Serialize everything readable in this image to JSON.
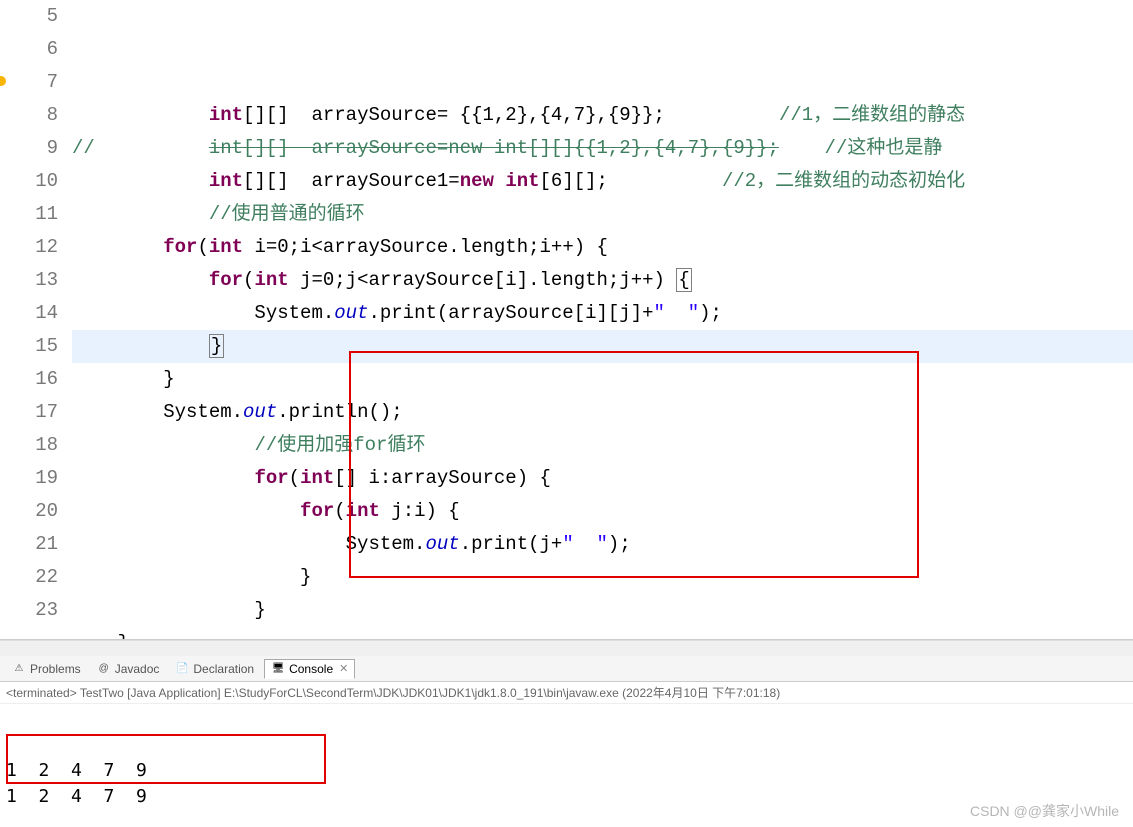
{
  "gutter": {
    "start": 5,
    "end": 23
  },
  "code_lines": [
    {
      "n": 5,
      "segs": [
        {
          "t": "            "
        },
        {
          "t": "int",
          "c": "kw"
        },
        {
          "t": "[][]  arraySource= {{1,2},{4,7},{9}};          "
        },
        {
          "t": "//1，二维数组的静态",
          "c": "comment"
        }
      ]
    },
    {
      "n": 6,
      "segs": [
        {
          "t": "//",
          "c": "comment"
        },
        {
          "t": "          "
        },
        {
          "t": "int[][]  arraySource=new int[][]{{1,2},{4,7},{9}};",
          "c": "comment-strike"
        },
        {
          "t": "    "
        },
        {
          "t": "//这种也是静",
          "c": "comment"
        }
      ]
    },
    {
      "n": 7,
      "segs": [
        {
          "t": "            "
        },
        {
          "t": "int",
          "c": "kw"
        },
        {
          "t": "[][]  arraySource1="
        },
        {
          "t": "new",
          "c": "kw"
        },
        {
          "t": " "
        },
        {
          "t": "int",
          "c": "kw"
        },
        {
          "t": "[6][];          "
        },
        {
          "t": "//2，二维数组的动态初始化",
          "c": "comment"
        }
      ],
      "marker": "warn"
    },
    {
      "n": 8,
      "segs": [
        {
          "t": "            "
        },
        {
          "t": "//使用普通的循环",
          "c": "comment"
        }
      ]
    },
    {
      "n": 9,
      "segs": [
        {
          "t": "        "
        },
        {
          "t": "for",
          "c": "kw"
        },
        {
          "t": "("
        },
        {
          "t": "int",
          "c": "kw"
        },
        {
          "t": " i=0;i<arraySource.length;i++) {"
        }
      ]
    },
    {
      "n": 10,
      "segs": [
        {
          "t": "            "
        },
        {
          "t": "for",
          "c": "kw"
        },
        {
          "t": "("
        },
        {
          "t": "int",
          "c": "kw"
        },
        {
          "t": " j=0;j<arraySource[i].length;j++) "
        },
        {
          "t": "{",
          "c": "match-brace"
        }
      ]
    },
    {
      "n": 11,
      "segs": [
        {
          "t": "                System."
        },
        {
          "t": "out",
          "c": "field"
        },
        {
          "t": ".print(arraySource[i][j]+"
        },
        {
          "t": "\"  \"",
          "c": "str"
        },
        {
          "t": ");"
        }
      ]
    },
    {
      "n": 12,
      "hl": true,
      "segs": [
        {
          "t": "            "
        },
        {
          "t": "}",
          "c": "match-brace"
        }
      ]
    },
    {
      "n": 13,
      "segs": [
        {
          "t": "        }"
        }
      ]
    },
    {
      "n": 14,
      "segs": [
        {
          "t": "        System."
        },
        {
          "t": "out",
          "c": "field"
        },
        {
          "t": ".println();"
        }
      ]
    },
    {
      "n": 15,
      "segs": [
        {
          "t": "                "
        },
        {
          "t": "//使用加强for循环",
          "c": "comment"
        }
      ]
    },
    {
      "n": 16,
      "segs": [
        {
          "t": "                "
        },
        {
          "t": "for",
          "c": "kw"
        },
        {
          "t": "("
        },
        {
          "t": "int",
          "c": "kw"
        },
        {
          "t": "[] i:arraySource) {"
        }
      ]
    },
    {
      "n": 17,
      "segs": [
        {
          "t": "                    "
        },
        {
          "t": "for",
          "c": "kw"
        },
        {
          "t": "("
        },
        {
          "t": "int",
          "c": "kw"
        },
        {
          "t": " j:i) {"
        }
      ]
    },
    {
      "n": 18,
      "segs": [
        {
          "t": "                        System."
        },
        {
          "t": "out",
          "c": "field"
        },
        {
          "t": ".print(j+"
        },
        {
          "t": "\"  \"",
          "c": "str"
        },
        {
          "t": ");"
        }
      ]
    },
    {
      "n": 19,
      "segs": [
        {
          "t": "                    }"
        }
      ]
    },
    {
      "n": 20,
      "segs": [
        {
          "t": "                }"
        }
      ]
    },
    {
      "n": 21,
      "segs": [
        {
          "t": "    }"
        }
      ]
    },
    {
      "n": 22,
      "segs": [
        {
          "t": "}"
        }
      ]
    },
    {
      "n": 23,
      "segs": [
        {
          "t": ""
        }
      ]
    }
  ],
  "tabs": {
    "items": [
      {
        "icon": "⚠",
        "label": "Problems",
        "active": false
      },
      {
        "icon": "@",
        "label": "Javadoc",
        "active": false
      },
      {
        "icon": "📄",
        "label": "Declaration",
        "active": false
      },
      {
        "icon": "🖥",
        "label": "Console",
        "active": true
      }
    ]
  },
  "console": {
    "header": "<terminated> TestTwo [Java Application] E:\\StudyForCL\\SecondTerm\\JDK\\JDK01\\JDK1\\jdk1.8.0_191\\bin\\javaw.exe (2022年4月10日 下午7:01:18)",
    "lines": [
      "1  2  4  7  9  ",
      "1  2  4  7  9  "
    ]
  },
  "watermark": "CSDN @@龚家小While"
}
